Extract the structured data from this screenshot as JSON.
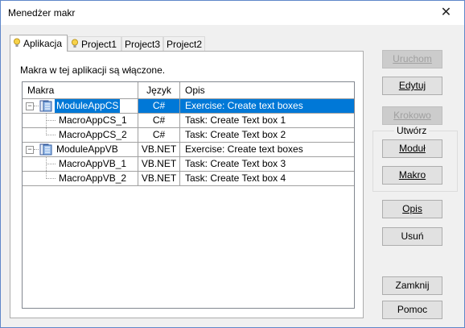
{
  "window": {
    "title": "Menedżer makr"
  },
  "tabs": [
    {
      "label": "Aplikacja",
      "active": true,
      "icon": "bulb-icon"
    },
    {
      "label": "Project1",
      "active": false,
      "icon": "bulb-icon"
    },
    {
      "label": "Project3",
      "active": false
    },
    {
      "label": "Project2",
      "active": false
    }
  ],
  "panel": {
    "info": "Makra w tej aplikacji są włączone."
  },
  "grid": {
    "columns": [
      "Makra",
      "Język",
      "Opis"
    ],
    "rows": [
      {
        "name": "ModuleAppCS",
        "lang": "C#",
        "desc": "Exercise: Create text boxes",
        "type": "module",
        "selected": true
      },
      {
        "name": "MacroAppCS_1",
        "lang": "C#",
        "desc": "Task: Create Text box 1",
        "type": "macro"
      },
      {
        "name": "MacroAppCS_2",
        "lang": "C#",
        "desc": "Task: Create Text box 2",
        "type": "macro"
      },
      {
        "name": "ModuleAppVB",
        "lang": "VB.NET",
        "desc": "Exercise: Create text boxes",
        "type": "module"
      },
      {
        "name": "MacroAppVB_1",
        "lang": "VB.NET",
        "desc": "Task: Create Text box 3",
        "type": "macro"
      },
      {
        "name": "MacroAppVB_2",
        "lang": "VB.NET",
        "desc": "Task: Create Text box 4",
        "type": "macro"
      }
    ]
  },
  "buttons": {
    "run": "Uruchom",
    "edit": "Edytuj",
    "step": "Krokowo",
    "create_group": "Utwórz",
    "module": "Moduł",
    "macro": "Makro",
    "description": "Opis",
    "delete": "Usuń",
    "close": "Zamknij",
    "help": "Pomoc"
  },
  "colors": {
    "selection": "#0078d7",
    "border": "#5f87c9"
  }
}
